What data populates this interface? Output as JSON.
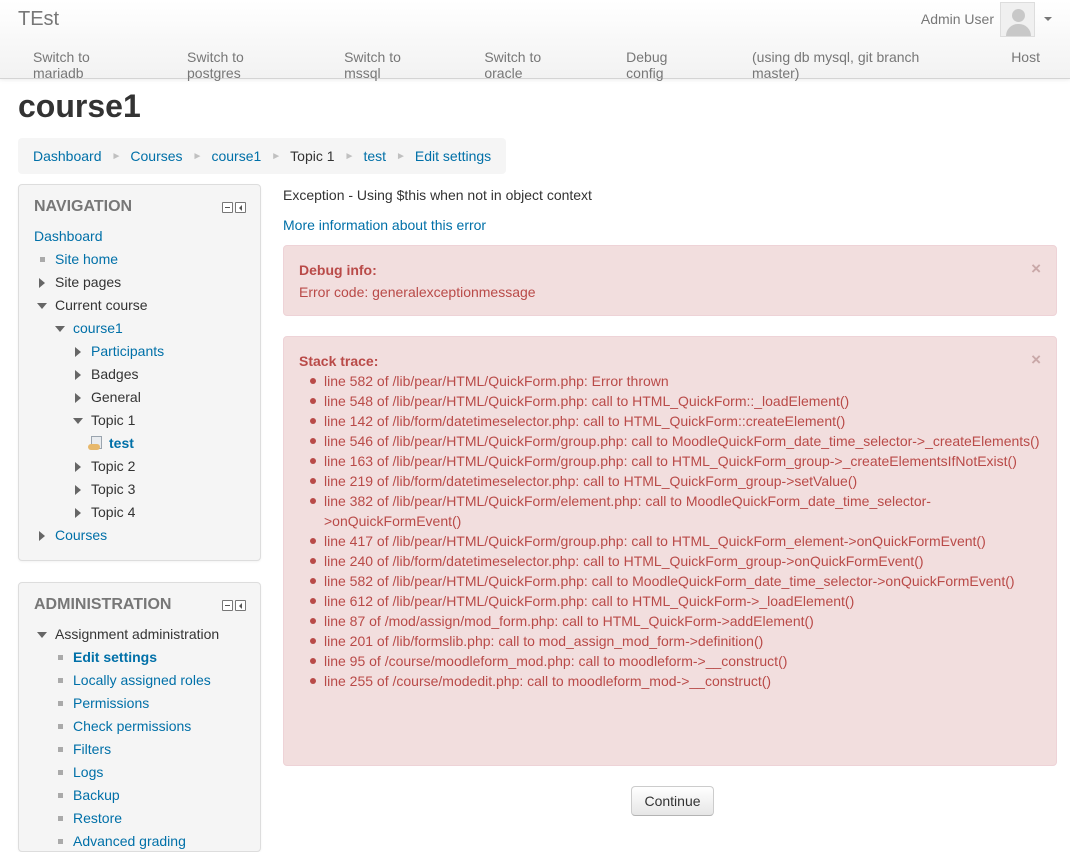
{
  "brand": "TEst",
  "user": {
    "name": "Admin User"
  },
  "custom_menu": [
    "Switch to mariadb",
    "Switch to postgres",
    "Switch to mssql",
    "Switch to oracle",
    "Debug config",
    "(using db mysql, git branch master)",
    "Host"
  ],
  "page_title": "course1",
  "breadcrumb": [
    "Dashboard",
    "Courses",
    "course1",
    "Topic 1",
    "test",
    "Edit settings"
  ],
  "navigation": {
    "title": "NAVIGATION",
    "items": [
      "Dashboard",
      "Site home",
      "Site pages",
      "Current course",
      "course1",
      "Participants",
      "Badges",
      "General",
      "Topic 1",
      "test",
      "Topic 2",
      "Topic 3",
      "Topic 4",
      "Courses"
    ]
  },
  "administration": {
    "title": "ADMINISTRATION",
    "items": [
      "Assignment administration",
      "Edit settings",
      "Locally assigned roles",
      "Permissions",
      "Check permissions",
      "Filters",
      "Logs",
      "Backup",
      "Restore",
      "Advanced grading"
    ]
  },
  "error": {
    "message": "Exception - Using $this when not in object context",
    "more_info": "More information about this error",
    "debug_title": "Debug info:",
    "debug_text": "Error code: generalexceptionmessage",
    "stack_title": "Stack trace:",
    "stack": [
      "line 582 of /lib/pear/HTML/QuickForm.php: Error thrown",
      "line 548 of /lib/pear/HTML/QuickForm.php: call to HTML_QuickForm::_loadElement()",
      "line 142 of /lib/form/datetimeselector.php: call to HTML_QuickForm::createElement()",
      "line 546 of /lib/pear/HTML/QuickForm/group.php: call to MoodleQuickForm_date_time_selector->_createElements()",
      "line 163 of /lib/pear/HTML/QuickForm/group.php: call to HTML_QuickForm_group->_createElementsIfNotExist()",
      "line 219 of /lib/form/datetimeselector.php: call to HTML_QuickForm_group->setValue()",
      "line 382 of /lib/pear/HTML/QuickForm/element.php: call to MoodleQuickForm_date_time_selector->onQuickFormEvent()",
      "line 417 of /lib/pear/HTML/QuickForm/group.php: call to HTML_QuickForm_element->onQuickFormEvent()",
      "line 240 of /lib/form/datetimeselector.php: call to HTML_QuickForm_group->onQuickFormEvent()",
      "line 582 of /lib/pear/HTML/QuickForm.php: call to MoodleQuickForm_date_time_selector->onQuickFormEvent()",
      "line 612 of /lib/pear/HTML/QuickForm.php: call to HTML_QuickForm->_loadElement()",
      "line 87 of /mod/assign/mod_form.php: call to HTML_QuickForm->addElement()",
      "line 201 of /lib/formslib.php: call to mod_assign_mod_form->definition()",
      "line 95 of /course/moodleform_mod.php: call to moodleform->__construct()",
      "line 255 of /course/modedit.php: call to moodleform_mod->__construct()"
    ],
    "close_symbol": "×"
  },
  "continue_label": "Continue",
  "colors": {
    "link": "#0070a8",
    "error_text": "#b94a48",
    "error_bg": "#f2dede",
    "muted": "#777777"
  }
}
